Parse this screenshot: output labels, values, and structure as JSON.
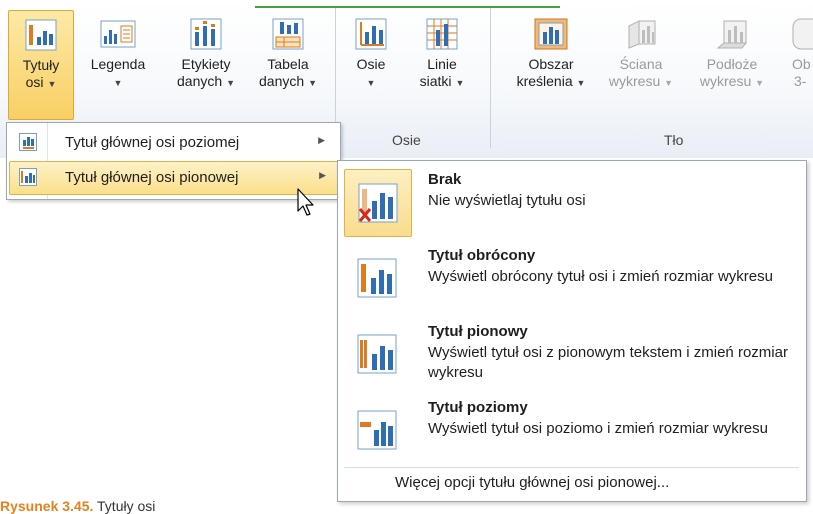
{
  "ribbon": {
    "buttons": [
      {
        "line1": "Tytuły",
        "line2": "osi",
        "arrow": "▼",
        "icon": "axis-titles-icon",
        "active": true
      },
      {
        "line1": "Legenda",
        "line2": "",
        "arrow": "▼",
        "icon": "legend-icon"
      },
      {
        "line1": "Etykiety",
        "line2": "danych",
        "arrow": "▼",
        "icon": "data-labels-icon"
      },
      {
        "line1": "Tabela",
        "line2": "danych",
        "arrow": "▼",
        "icon": "data-table-icon"
      },
      {
        "line1": "Osie",
        "line2": "",
        "arrow": "▼",
        "icon": "axes-icon"
      },
      {
        "line1": "Linie",
        "line2": "siatki",
        "arrow": "▼",
        "icon": "gridlines-icon"
      },
      {
        "line1": "Obszar",
        "line2": "kreślenia",
        "arrow": "▼",
        "icon": "plot-area-icon"
      },
      {
        "line1": "Ściana",
        "line2": "wykresu",
        "arrow": "▼",
        "icon": "chart-wall-icon",
        "disabled": true
      },
      {
        "line1": "Podłoże",
        "line2": "wykresu",
        "arrow": "▼",
        "icon": "chart-floor-icon",
        "disabled": true
      },
      {
        "line1": "Ob",
        "line2": "3-",
        "arrow": "",
        "icon": "3d-rotation-icon",
        "disabled": true
      }
    ],
    "groups": {
      "axes": "Osie",
      "background": "Tło"
    }
  },
  "menu1": {
    "items": [
      {
        "label": "Tytuł głównej osi poziomej",
        "arrow": "▶"
      },
      {
        "label": "Tytuł głównej osi pionowej",
        "arrow": "▶"
      }
    ]
  },
  "menu2": {
    "options": [
      {
        "title": "Brak",
        "desc": "Nie wyświetlaj tytułu osi"
      },
      {
        "title": "Tytuł obrócony",
        "desc": "Wyświetl obrócony tytuł osi i zmień rozmiar wykresu"
      },
      {
        "title": "Tytuł pionowy",
        "desc": "Wyświetl tytuł osi z pionowym tekstem i zmień rozmiar wykresu"
      },
      {
        "title": "Tytuł poziomy",
        "desc": "Wyświetl tytuł osi poziomo i zmień rozmiar wykresu"
      }
    ],
    "more": "Więcej opcji tytułu głównej osi pionowej..."
  },
  "caption": {
    "label": "Rysunek 3.45.",
    "text": "Tytuły osi"
  },
  "colors": {
    "accent": "#e6821e",
    "hover": "#fbdf8a",
    "active": "#f8cf63",
    "group_line": "#43a047"
  }
}
